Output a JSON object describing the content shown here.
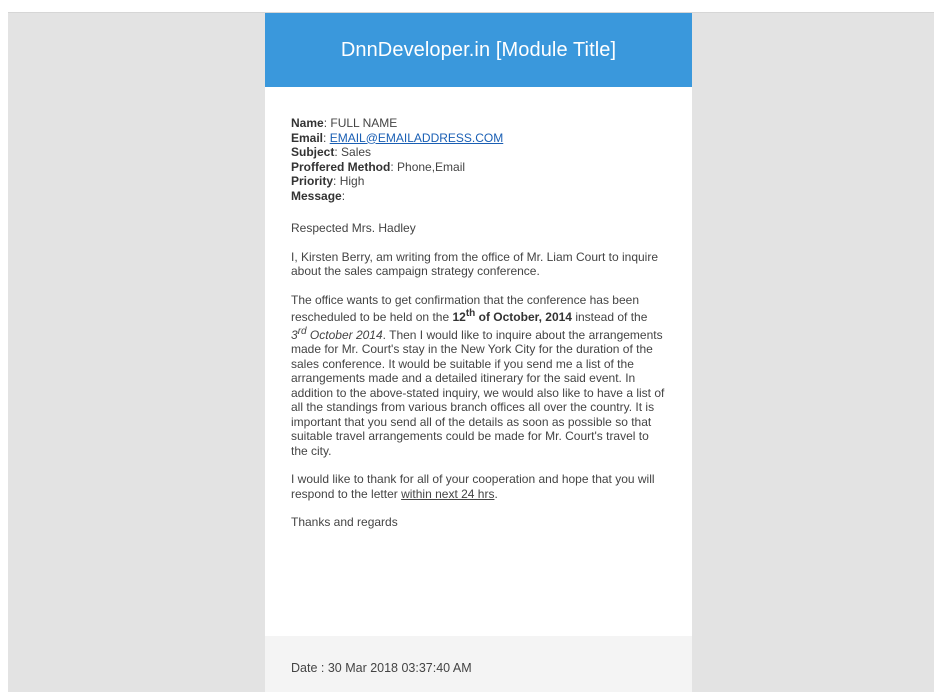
{
  "header": {
    "title": "DnnDeveloper.in [Module Title]"
  },
  "fields": {
    "name_label": "Name",
    "name_value": "FULL NAME",
    "email_label": "Email",
    "email_value": "EMAIL@EMAILADDRESS.COM",
    "subject_label": "Subject",
    "subject_value": "Sales",
    "method_label": "Proffered Method",
    "method_value": "Phone,Email",
    "priority_label": "Priority",
    "priority_value": "High",
    "message_label": "Message"
  },
  "letter": {
    "greeting": "Respected Mrs. Hadley",
    "para1": "I, Kirsten Berry, am writing from the office of Mr. Liam Court to inquire about the sales campaign strategy conference.",
    "para2_a": "The office wants to get confirmation that the conference has been rescheduled to be held on the ",
    "para2_day": "12",
    "para2_day_sup": "th",
    "para2_date_rest": " of October, 2014",
    "para2_b": " instead of the ",
    "para2_old_day": "3",
    "para2_old_sup": "rd",
    "para2_old_rest": " October 2014",
    "para2_c": ". Then I would like to inquire about the arrangements made for Mr. Court's stay in the New York City for the duration of the sales conference. It would be suitable if you send me a list of the arrangements made and a detailed itinerary for the said event. In addition to the above-stated inquiry, we would also like to have a list of all the standings from various branch offices all over the country. It is important that you send all of the details as soon as possible so that suitable travel arrangements could be made for Mr. Court's travel to the city.",
    "para3_a": "I would like to thank for all of your cooperation and hope that you will respond to the letter ",
    "para3_link": "within next 24 hrs",
    "para3_end": ".",
    "closing": "Thanks and regards"
  },
  "footer": {
    "date_text": "Date : 30 Mar 2018 03:37:40 AM"
  }
}
